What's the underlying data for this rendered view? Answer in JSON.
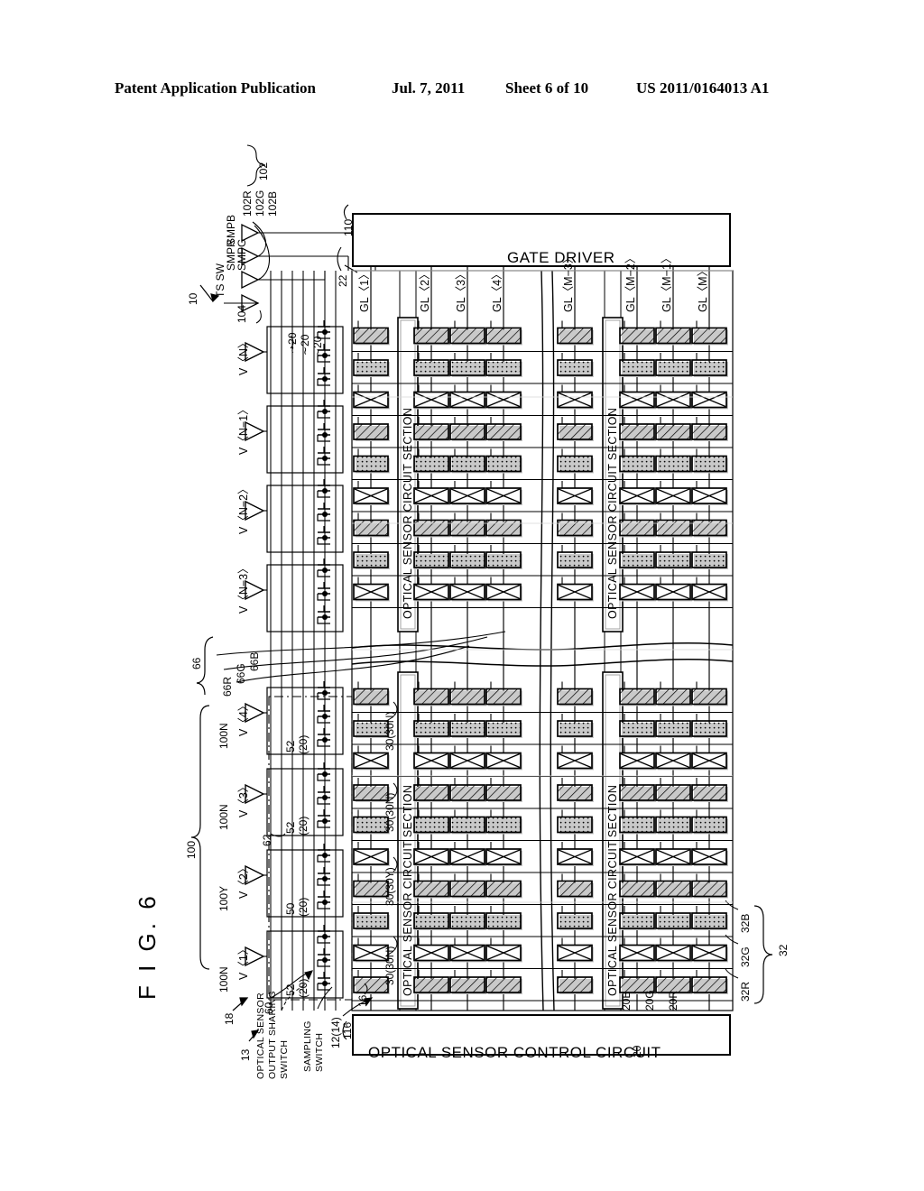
{
  "header": {
    "publication": "Patent Application Publication",
    "date": "Jul. 7, 2011",
    "sheet": "Sheet 6 of 10",
    "patent_number": "US 2011/0164013 A1"
  },
  "figure": {
    "label": "F I G.  6",
    "reference": "10"
  },
  "blocks": {
    "gate_driver": {
      "label": "GATE DRIVER",
      "ref": "110"
    },
    "optical_sensor_control_circuit": {
      "label": "OPTICAL SENSOR CONTROL CIRCUIT",
      "ref": "116"
    },
    "sensor_sections": [
      {
        "label": "OPTICAL SENSOR CIRCUIT SECTION"
      },
      {
        "label": "OPTICAL SENSOR CIRCUIT SECTION"
      },
      {
        "label": "OPTICAL SENSOR CIRCUIT SECTION"
      },
      {
        "label": "OPTICAL SENSOR CIRCUIT SECTION"
      }
    ]
  },
  "gate_lines": [
    "GL〈1〉",
    "GL〈2〉",
    "GL〈3〉",
    "GL〈4〉",
    "GL〈M−3〉",
    "GL〈M−2〉",
    "GL〈M−1〉",
    "GL〈M〉"
  ],
  "gate_line_ref": "22",
  "sampling_signals": {
    "labels": [
      "SMPB",
      "SMPG",
      "SMPR"
    ],
    "ts_sw": "TS SW",
    "buffer_refs": [
      "102R",
      "102G",
      "102B"
    ],
    "group_ref": "102",
    "ts_ref": "104"
  },
  "video_lines_top": [
    {
      "label": "V〈N〉"
    },
    {
      "label": "V〈N−1〉"
    },
    {
      "label": "V〈N−2〉"
    },
    {
      "label": "V〈N−3〉"
    }
  ],
  "video_lines_bottom": [
    {
      "label": "V〈4〉",
      "group": "100N"
    },
    {
      "label": "V〈3〉",
      "group": "100N"
    },
    {
      "label": "V〈2〉",
      "group": "100Y"
    },
    {
      "label": "V〈1〉",
      "group": "100N"
    }
  ],
  "video_group_ref": "100",
  "source_refs": [
    "∼20",
    "∼20",
    "∼20"
  ],
  "switch_refs": [
    {
      "text": "52",
      "sub": "(20)"
    },
    {
      "text": "52",
      "sub": "(20)"
    },
    {
      "text": "50",
      "sub": "(20)"
    },
    {
      "text": "52",
      "sub": "(20)"
    }
  ],
  "sensor_out_lines": {
    "group_ref": "66",
    "labels": [
      "66R",
      "66G",
      "66B"
    ]
  },
  "sensor_section_refs": [
    "30(30N)",
    "30(30N)",
    "30(30Y)",
    "30(30N)"
  ],
  "annotations": {
    "optical_sensor_output_sharing_switch": "OPTICAL SENSOR\nOUTPUT SHARING\nSWITCH",
    "sampling_switch": "SAMPLING\nSWITCH",
    "ref_13": "13",
    "ref_60": "60",
    "ref_18": "18",
    "ref_62": "62",
    "ref_12_14": "12(14)",
    "ref_16": "16"
  },
  "pixel_legend": {
    "group_ref": "32",
    "labels": [
      "32R",
      "32G",
      "32B"
    ]
  },
  "sensor_out_bottom": {
    "group_ref": "20",
    "labels": [
      "20B",
      "20G",
      "20R"
    ]
  },
  "colors": {
    "ink": "#000000",
    "paper": "#ffffff",
    "grid_gray": "#8a8a8a"
  }
}
